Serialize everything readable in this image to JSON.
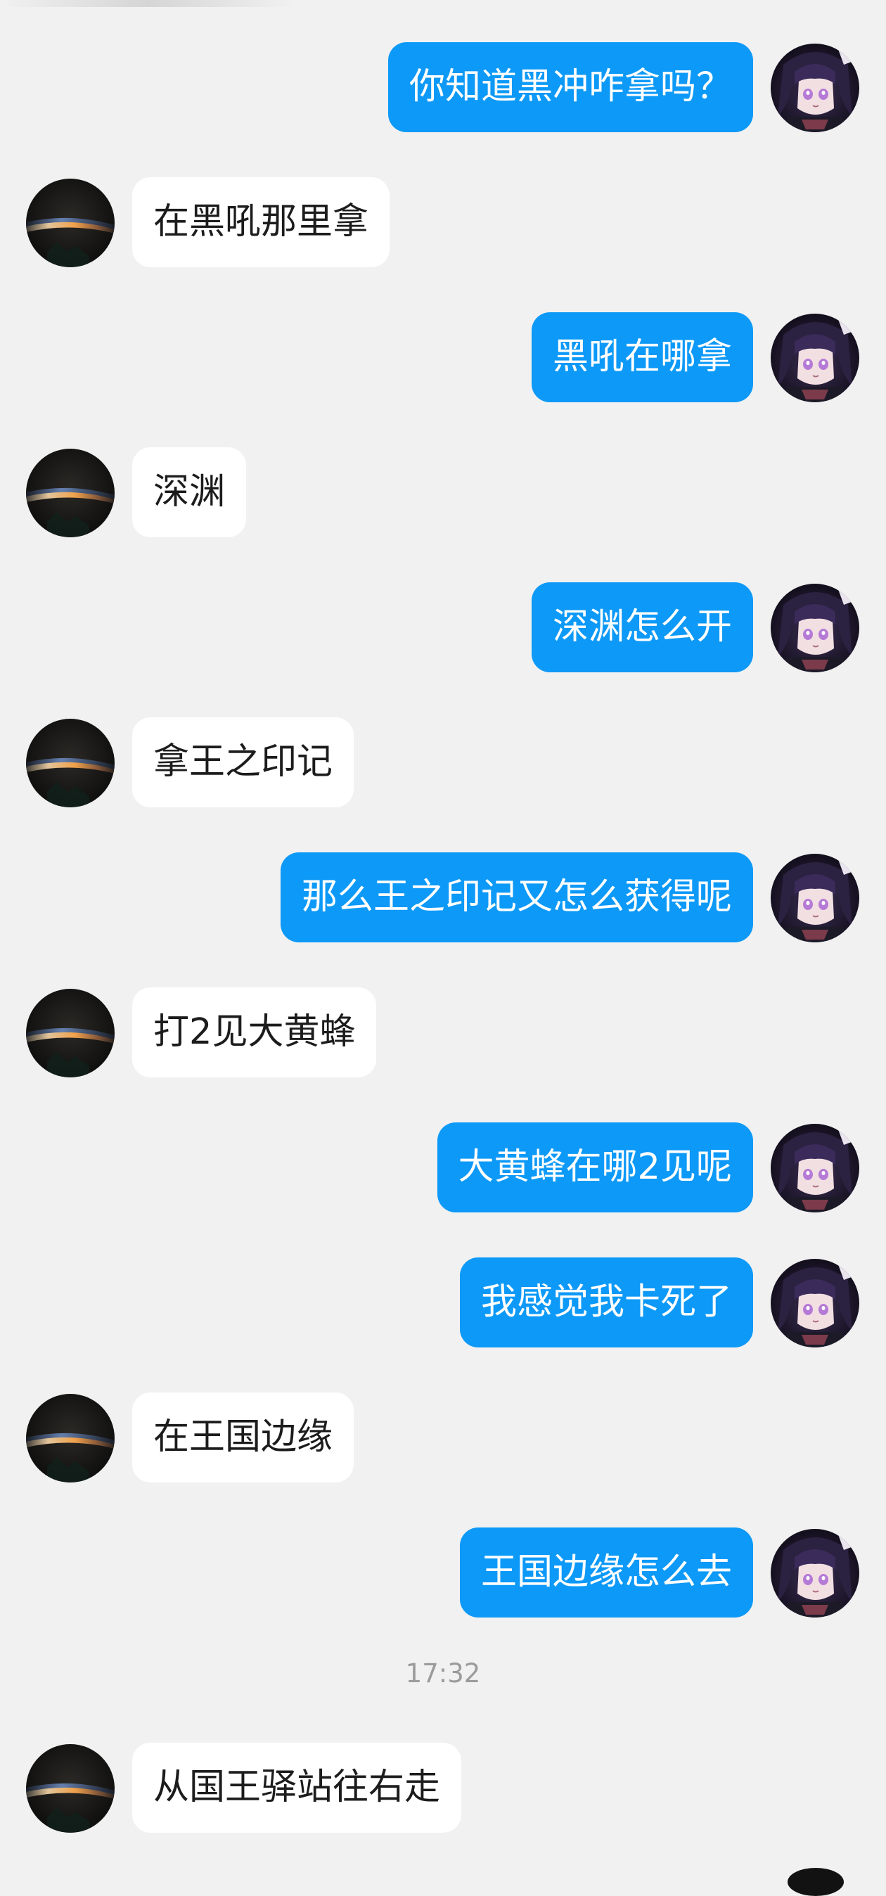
{
  "timestamp": "17:32",
  "messages": [
    {
      "side": "right",
      "text": "你知道黑冲咋拿吗？"
    },
    {
      "side": "left",
      "text": "在黑吼那里拿"
    },
    {
      "side": "right",
      "text": "黑吼在哪拿"
    },
    {
      "side": "left",
      "text": "深渊"
    },
    {
      "side": "right",
      "text": "深渊怎么开"
    },
    {
      "side": "left",
      "text": "拿王之印记"
    },
    {
      "side": "right",
      "text": "那么王之印记又怎么获得呢"
    },
    {
      "side": "left",
      "text": "打2见大黄蜂"
    },
    {
      "side": "right",
      "text": "大黄蜂在哪2见呢"
    },
    {
      "side": "right",
      "text": "我感觉我卡死了"
    },
    {
      "side": "left",
      "text": "在王国边缘"
    },
    {
      "side": "right",
      "text": "王国边缘怎么去"
    },
    {
      "side": "left",
      "text": "从国王驿站往右走"
    }
  ],
  "colors": {
    "background": "#f1f1f1",
    "outgoing_bubble": "#0d99f7",
    "incoming_bubble": "#ffffff",
    "timestamp_text": "#9b9b9b"
  },
  "icons": {
    "self_avatar": "anime-character-avatar",
    "contact_avatar": "horizon-glow-avatar"
  }
}
